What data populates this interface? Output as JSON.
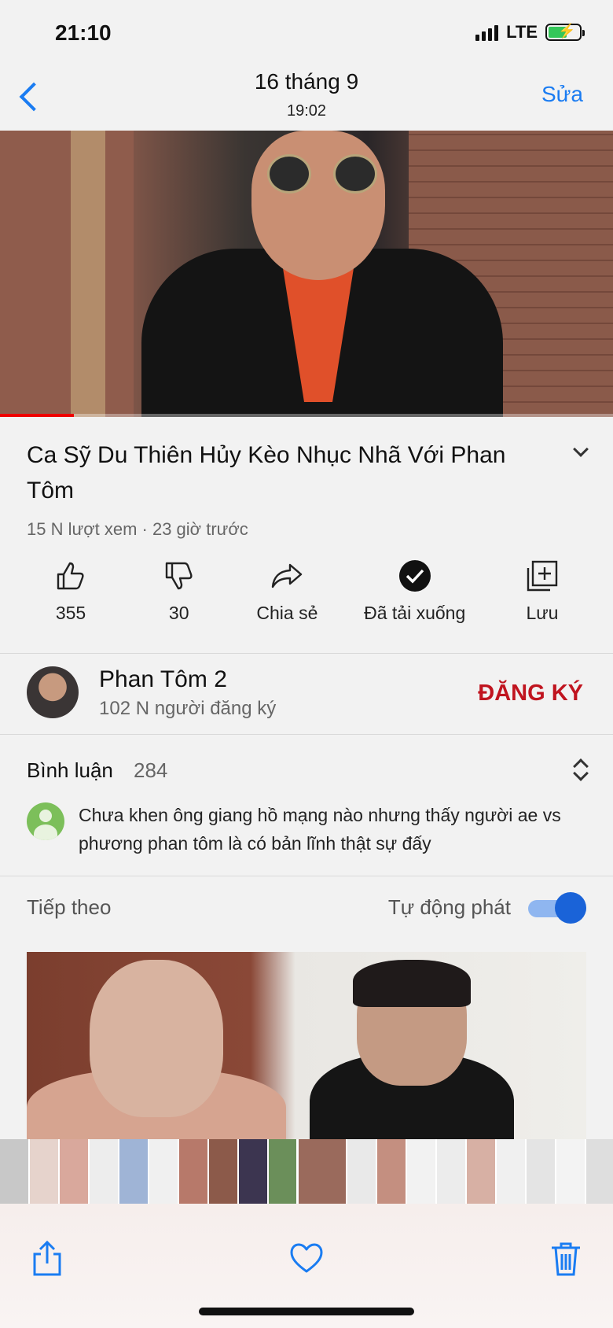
{
  "status_bar": {
    "time": "21:10",
    "network": "LTE"
  },
  "photo_header": {
    "date": "16 tháng 9",
    "time": "19:02",
    "edit_label": "Sửa"
  },
  "video": {
    "title": "Ca Sỹ Du Thiên Hủy Kèo Nhục Nhã Với Phan Tôm",
    "meta": "15 N lượt xem · 23 giờ trước",
    "progress_fraction": 0.12
  },
  "actions": {
    "like": "355",
    "dislike": "30",
    "share": "Chia sẻ",
    "downloaded": "Đã tải xuống",
    "save": "Lưu"
  },
  "channel": {
    "name": "Phan Tôm 2",
    "subscribers": "102 N người đăng ký",
    "subscribe_label": "ĐĂNG KÝ"
  },
  "comments": {
    "title": "Bình luận",
    "count": "284",
    "top_comment": "Chưa khen ông giang hồ mạng nào nhưng thấy người ae vs phương phan tôm là có bản lĩnh thật sự đấy"
  },
  "up_next": {
    "title": "Tiếp theo",
    "autoplay_label": "Tự động phát",
    "autoplay_on": true
  },
  "icons": {
    "back": "chevron-left-icon",
    "like": "thumbs-up-icon",
    "dislike": "thumbs-down-icon",
    "share": "share-arrow-icon",
    "downloaded": "check-circle-icon",
    "save": "add-to-playlist-icon",
    "toolbar_share": "share-icon",
    "toolbar_favorite": "heart-icon",
    "toolbar_delete": "trash-icon"
  },
  "colors": {
    "accent": "#1a7cf2",
    "subscribe": "#c0141f",
    "battery": "#34c759",
    "progress": "#e00000"
  }
}
